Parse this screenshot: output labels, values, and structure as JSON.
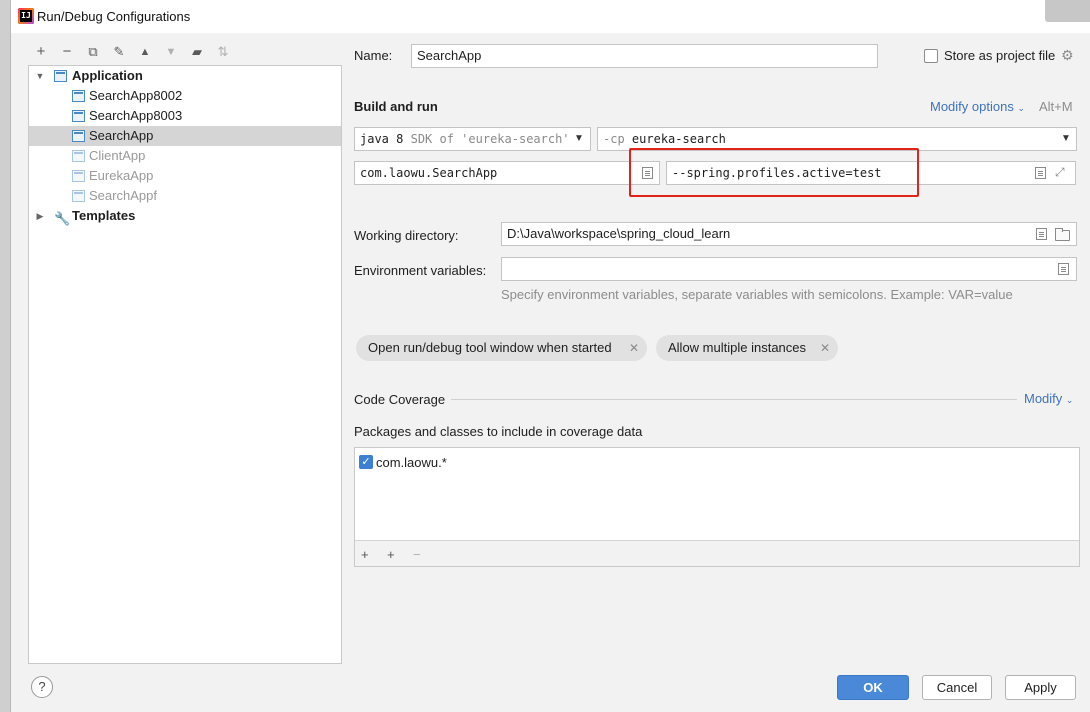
{
  "window": {
    "title": "Run/Debug Configurations"
  },
  "toolbar": {
    "icons": [
      "add-icon",
      "remove-icon",
      "copy-icon",
      "wrench-icon",
      "move-up-icon",
      "move-down-icon",
      "new-folder-icon",
      "sort-icon"
    ],
    "glyphs": [
      "+",
      "−",
      "⧉",
      "🔧",
      "▲",
      "▼",
      "📁",
      "⇅"
    ]
  },
  "tree": {
    "application_label": "Application",
    "items": [
      {
        "label": "SearchApp8002"
      },
      {
        "label": "SearchApp8003"
      },
      {
        "label": "SearchApp"
      },
      {
        "label": "ClientApp"
      },
      {
        "label": "EurekaApp"
      },
      {
        "label": "SearchAppf"
      }
    ],
    "templates_label": "Templates"
  },
  "form": {
    "name_label": "Name:",
    "name_value": "SearchApp",
    "store_label": "Store as project file",
    "build_run_title": "Build and run",
    "modify_options_label": "Modify options",
    "modify_options_shortcut": "Alt+M",
    "jre_main": "java 8",
    "jre_hint": "SDK of 'eureka-search'",
    "classpath_flag": "-cp",
    "classpath_value": "eureka-search",
    "main_class": "com.laowu.SearchApp",
    "program_args": "--spring.profiles.active=test",
    "working_dir_label": "Working directory:",
    "working_dir_value": "D:\\Java\\workspace\\spring_cloud_learn",
    "env_label": "Environment variables:",
    "env_value": "",
    "env_hint": "Specify environment variables, separate variables with semicolons. Example: VAR=value",
    "chip_open_tool": "Open run/debug tool window when started",
    "chip_multiple": "Allow multiple instances"
  },
  "coverage": {
    "title": "Code Coverage",
    "modify_label": "Modify",
    "packages_label": "Packages and classes to include in coverage data",
    "items": [
      {
        "label": "com.laowu.*",
        "checked": true
      }
    ]
  },
  "buttons": {
    "ok": "OK",
    "cancel": "Cancel",
    "apply": "Apply",
    "help": "?"
  },
  "colors": {
    "accent": "#4a88d8",
    "link": "#3e73b9",
    "highlight_box": "#e2231a"
  }
}
